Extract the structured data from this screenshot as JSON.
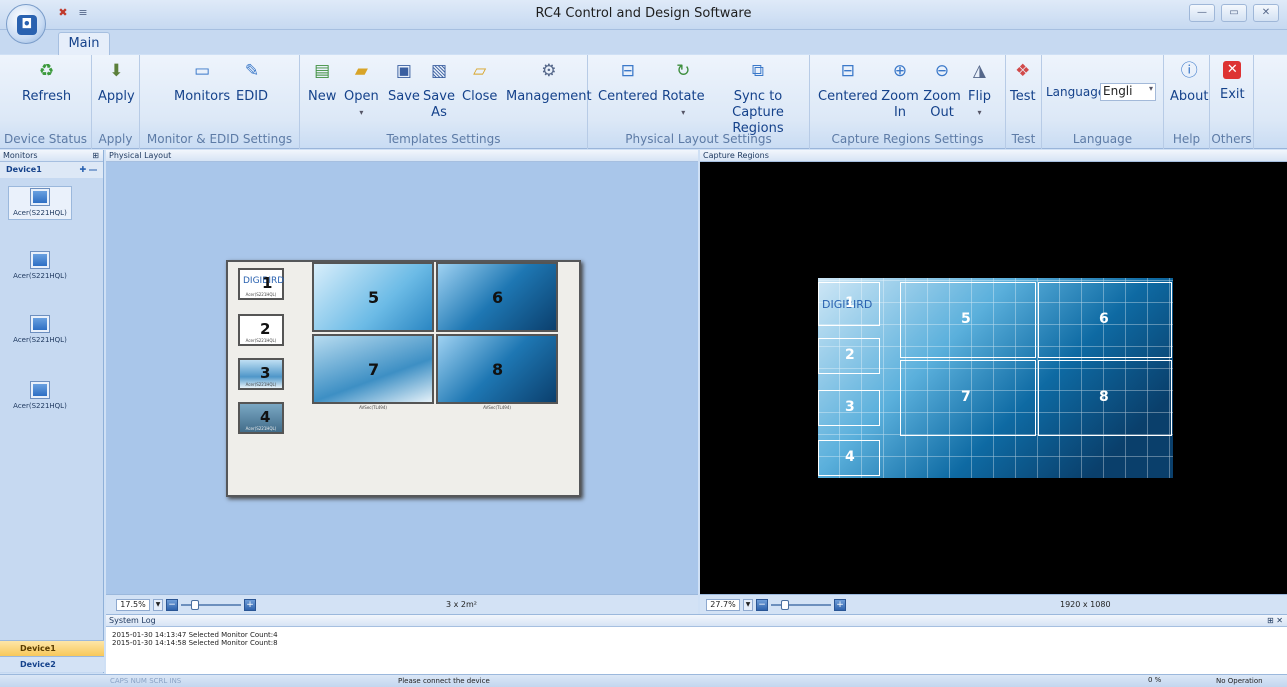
{
  "window": {
    "title": "RC4 Control and Design Software",
    "app_button_glyph": "◘",
    "controls": {
      "minimize": "—",
      "maximize": "▭",
      "close": "✕"
    }
  },
  "tabs": {
    "main": "Main"
  },
  "ribbon": {
    "groups": [
      {
        "id": "device-status",
        "label": "Device Status",
        "buttons": [
          {
            "label": "Refresh",
            "icon": "refresh-icon"
          }
        ]
      },
      {
        "id": "apply",
        "label": "Apply",
        "buttons": [
          {
            "label": "Apply",
            "icon": "apply-icon"
          }
        ]
      },
      {
        "id": "monitor-edid",
        "label": "Monitor & EDID Settings",
        "buttons": [
          {
            "label": "Monitors",
            "icon": "monitor-icon"
          },
          {
            "label": "EDID",
            "icon": "edid-icon"
          }
        ]
      },
      {
        "id": "templates",
        "label": "Templates Settings",
        "buttons": [
          {
            "label": "New",
            "icon": "new-icon"
          },
          {
            "label": "Open",
            "icon": "open-folder-icon"
          },
          {
            "label": "Save",
            "icon": "save-icon"
          },
          {
            "label": "Save As",
            "icon": "save-as-icon"
          },
          {
            "label": "Close",
            "icon": "close-folder-icon"
          },
          {
            "label": "Management",
            "icon": "management-icon"
          }
        ]
      },
      {
        "id": "physical",
        "label": "Physical Layout Settings",
        "buttons": [
          {
            "label": "Centered",
            "icon": "centered-icon"
          },
          {
            "label": "Rotate",
            "icon": "rotate-icon"
          },
          {
            "label": "Sync to Capture Regions",
            "icon": "sync-icon"
          }
        ]
      },
      {
        "id": "capture",
        "label": "Capture Regions Settings",
        "buttons": [
          {
            "label": "Centered",
            "icon": "centered-icon"
          },
          {
            "label": "Zoom In",
            "icon": "zoom-in-icon"
          },
          {
            "label": "Zoom Out",
            "icon": "zoom-out-icon"
          },
          {
            "label": "Flip",
            "icon": "flip-icon"
          }
        ]
      },
      {
        "id": "test",
        "label": "Test",
        "buttons": [
          {
            "label": "Test",
            "icon": "test-icon"
          }
        ]
      },
      {
        "id": "language",
        "label": "Language"
      },
      {
        "id": "help",
        "label": "Help",
        "buttons": [
          {
            "label": "About",
            "icon": "info-icon"
          }
        ]
      },
      {
        "id": "others",
        "label": "Others",
        "buttons": [
          {
            "label": "Exit",
            "icon": "exit-icon"
          }
        ]
      }
    ],
    "language": {
      "label": "Language",
      "value": "Engli"
    }
  },
  "panels": {
    "monitors": {
      "title": "Monitors",
      "device": "Device1",
      "items": [
        "Acer(S221HQL)",
        "Acer(S221HQL)",
        "Acer(S221HQL)",
        "Acer(S221HQL)"
      ]
    },
    "physical": {
      "title": "Physical Layout",
      "zoom": "17.5%",
      "size_text": "3 x 2m²",
      "logo": "DIGIBIRD",
      "tiles": [
        {
          "num": "1",
          "label": "Acer(S221HQL)"
        },
        {
          "num": "2",
          "label": "Acer(S221HQL)"
        },
        {
          "num": "3",
          "label": "Acer(S221HQL)"
        },
        {
          "num": "4",
          "label": "Acer(S221HQL)"
        },
        {
          "num": "5",
          "label": ""
        },
        {
          "num": "6",
          "label": ""
        },
        {
          "num": "7",
          "label": "AVSec(TL494)"
        },
        {
          "num": "8",
          "label": "AVSec(TL494)"
        }
      ]
    },
    "capture": {
      "title": "Capture Regions",
      "zoom": "27.7%",
      "resolution": "1920 x 1080",
      "logo": "DIGIBIRD",
      "regions": [
        "1",
        "2",
        "3",
        "4",
        "5",
        "6",
        "7",
        "8"
      ]
    },
    "log": {
      "title": "System Log",
      "lines": [
        "2015-01-30 14:13:47 Selected Monitor Count:4",
        "2015-01-30 14:14:58 Selected Monitor Count:8"
      ]
    },
    "device_tabs": [
      "Device1",
      "Device2"
    ]
  },
  "statusbar": {
    "keys": "CAPS  NUM  SCRL  INS",
    "message": "Please connect the device",
    "progress": "0 %",
    "operation": "No Operation"
  }
}
